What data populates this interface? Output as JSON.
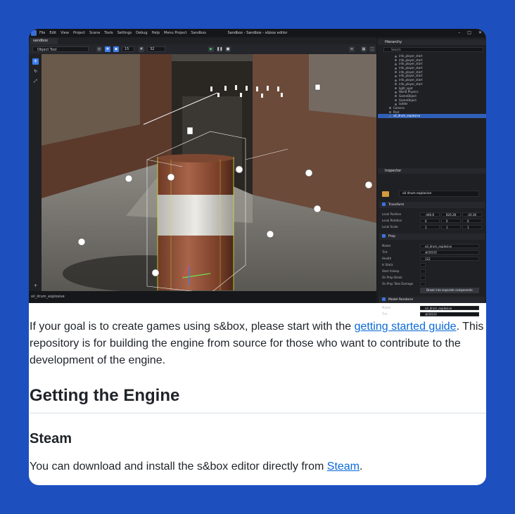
{
  "editor": {
    "window_title": "Sandbox - Sandbox - s&box editor",
    "menu_items": [
      "File",
      "Edit",
      "View",
      "Project",
      "Scene",
      "Tools",
      "Settings",
      "Debug",
      "Help",
      "Menu Project",
      "Sandbox"
    ],
    "scene_tab": "sandbox",
    "tool_select": "Object Tool",
    "grid_value": "15",
    "step_value": "32",
    "status_text": "oil_drum_explosive",
    "hierarchy": {
      "title": "Hierarchy",
      "search_placeholder": "Search",
      "items": [
        "info_player_start",
        "info_player_start",
        "info_player_start",
        "info_player_start",
        "info_player_start",
        "info_player_start",
        "info_player_start",
        "info_player_start",
        "light_spot",
        "World Physics",
        "GameObject",
        "GameObject",
        "ladder",
        "Camera",
        "Post",
        "oil_drum_explosive"
      ]
    },
    "inspector": {
      "title": "Inspector",
      "object_name": "oil drum explosive",
      "transform_title": "Transform",
      "position_label": "Local Position",
      "position": [
        "-446.8",
        "826.38",
        "-24.38"
      ],
      "rotation_label": "Local Rotation",
      "rotation": [
        "0",
        "0",
        "0"
      ],
      "scale_label": "Local Scale",
      "scale": [
        "1",
        "1",
        "1"
      ],
      "prop_title": "Prop",
      "prop_rows": [
        {
          "label": "Model",
          "value": "oil_drum_explosive"
        },
        {
          "label": "Tint",
          "value": "#FFFFFF"
        },
        {
          "label": "Health",
          "value": "122"
        },
        {
          "label": "Is Static",
          "value": ""
        },
        {
          "label": "Start Asleep",
          "value": ""
        },
        {
          "label": "On Prop Break",
          "value": ""
        },
        {
          "label": "On Prop Take Damage",
          "value": ""
        }
      ],
      "break_button": "Break into separate components",
      "renderer_title": "Model Renderer",
      "renderer_rows": [
        {
          "label": "Model",
          "value": "oil_drum_explosive"
        },
        {
          "label": "Tint",
          "value": "#FFFFFF"
        }
      ]
    }
  },
  "content": {
    "intro_before_link": "If your goal is to create games using s&box, please start with the ",
    "intro_link": "getting started guide",
    "intro_after_link": ". This repository is for building the engine from source for those who want to contribute to the development of the engine.",
    "heading": "Getting the Engine",
    "subheading": "Steam",
    "steam_before_link": "You can download and install the s&box editor directly from ",
    "steam_link": "Steam",
    "steam_after_link": "."
  },
  "colors": {
    "page_background": "#1d4fbf",
    "card_background": "#ffffff",
    "link": "#0969da",
    "editor_accent": "#3d7df2"
  }
}
